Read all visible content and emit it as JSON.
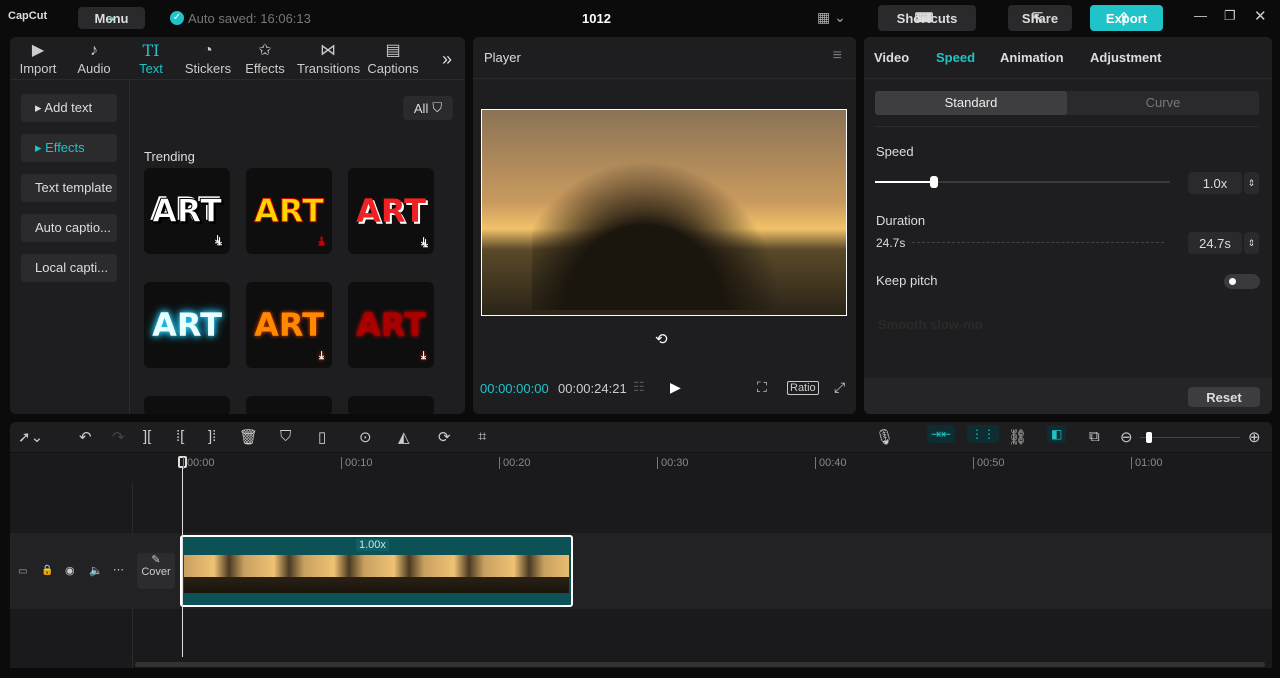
{
  "topbar": {
    "logo": "CapCut",
    "menu": "Menu",
    "autosave": "Auto saved: 16:06:13",
    "project": "1012",
    "shortcuts": "Shortcuts",
    "share": "Share",
    "export": "Export"
  },
  "media_tabs": [
    {
      "label": "Import",
      "icon": "▶"
    },
    {
      "label": "Audio",
      "icon": "♪"
    },
    {
      "label": "Text",
      "icon": "TI"
    },
    {
      "label": "Stickers",
      "icon": "◔"
    },
    {
      "label": "Effects",
      "icon": "✩"
    },
    {
      "label": "Transitions",
      "icon": "⋈"
    },
    {
      "label": "Captions",
      "icon": "▤"
    }
  ],
  "text_sidebar": [
    "Add text",
    "Effects",
    "Text template",
    "Auto captio...",
    "Local capti..."
  ],
  "filter": "All",
  "section": "Trending",
  "art_label": "ART",
  "player": {
    "title": "Player",
    "current": "00:00:00:00",
    "total": "00:00:24:21",
    "ratio": "Ratio"
  },
  "props": {
    "tabs": [
      "Video",
      "Speed",
      "Animation",
      "Adjustment"
    ],
    "modes": [
      "Standard",
      "Curve"
    ],
    "speed_label": "Speed",
    "speed_value": "1.0x",
    "speed_fraction": 0.2,
    "duration_label": "Duration",
    "duration_left": "24.7s",
    "duration_value": "24.7s",
    "keep_pitch": "Keep pitch",
    "keep_pitch_on": false,
    "smooth": "Smooth slow-mo",
    "reset": "Reset"
  },
  "timeline": {
    "ticks": [
      "00:00",
      "00:10",
      "00:20",
      "00:30",
      "00:40",
      "00:50",
      "01:00"
    ],
    "clip_speed": "1.00x",
    "cover": "Cover"
  },
  "colors": {
    "accent": "#1fc3c8",
    "clip": "#0c5156"
  }
}
